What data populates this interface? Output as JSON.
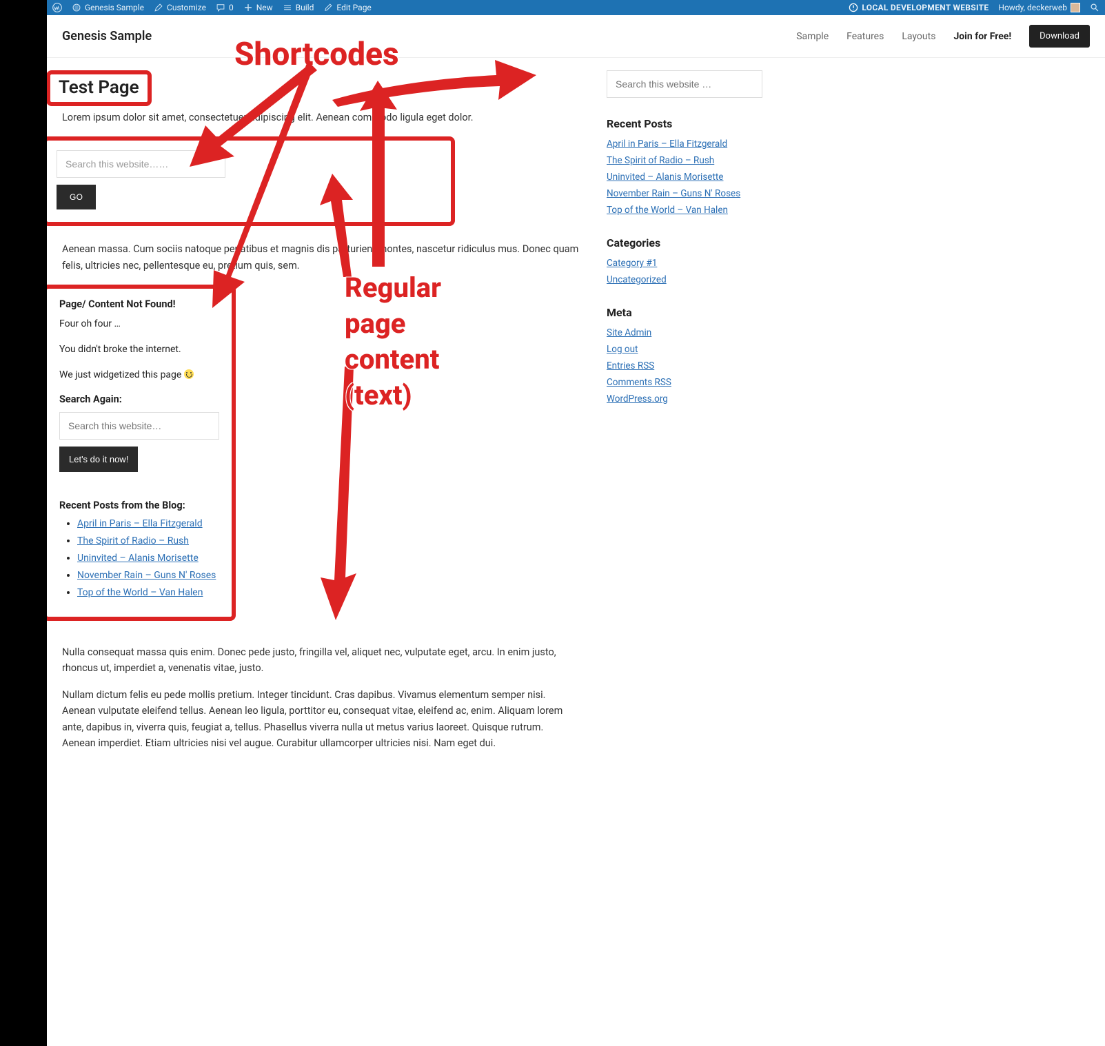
{
  "adminbar": {
    "site_name": "Genesis Sample",
    "customize": "Customize",
    "comments": "0",
    "new": "New",
    "build": "Build",
    "edit_page": "Edit Page",
    "local_dev": "LOCAL DEVELOPMENT WEBSITE",
    "howdy": "Howdy, deckerweb"
  },
  "header": {
    "title": "Genesis Sample",
    "nav": [
      "Sample",
      "Features",
      "Layouts"
    ],
    "nav_bold": "Join for Free!",
    "download": "Download"
  },
  "annotations": {
    "shortcodes": "Shortcodes",
    "regular": "Regular page content (text)"
  },
  "main": {
    "page_title": "Test Page",
    "lorem": "Lorem ipsum dolor sit amet, consectetuer adipiscing elit. Aenean commodo ligula eget dolor.",
    "search1_ph": "Search this website……",
    "go": "GO",
    "para2": "Aenean massa. Cum sociis natoque penatibus et magnis dis parturient montes, nascetur ridiculus mus. Donec quam felis, ultricies nec, pellentesque eu, pretium quis, sem.",
    "widget": {
      "h404": "Page/ Content Not Found!",
      "p1": "Four oh four …",
      "p2": "You didn't broke the internet.",
      "p3": "We just widgetized this page ",
      "search_again": "Search Again:",
      "search2_ph": "Search this website…",
      "do_it": "Let's do it now!",
      "recent_h": "Recent Posts from the Blog:",
      "posts": [
        "April in Paris – Ella Fitzgerald",
        "The Spirit of Radio – Rush",
        "Uninvited – Alanis Morisette",
        "November Rain – Guns N' Roses",
        "Top of the World – Van Halen"
      ]
    },
    "para3": "Nulla consequat massa quis enim. Donec pede justo, fringilla vel, aliquet nec, vulputate eget, arcu. In enim justo, rhoncus ut, imperdiet a, venenatis vitae, justo.",
    "para4": "Nullam dictum felis eu pede mollis pretium. Integer tincidunt. Cras dapibus. Vivamus elementum semper nisi. Aenean vulputate eleifend tellus. Aenean leo ligula, porttitor eu, consequat vitae, eleifend ac, enim. Aliquam lorem ante, dapibus in, viverra quis, feugiat a, tellus. Phasellus viverra nulla ut metus varius laoreet. Quisque rutrum. Aenean imperdiet. Etiam ultricies nisi vel augue. Curabitur ullamcorper ultricies nisi. Nam eget dui."
  },
  "sidebar": {
    "search_ph": "Search this website …",
    "recent_h": "Recent Posts",
    "recent": [
      "April in Paris – Ella Fitzgerald",
      "The Spirit of Radio – Rush",
      "Uninvited – Alanis Morisette",
      "November Rain – Guns N' Roses",
      "Top of the World – Van Halen"
    ],
    "cat_h": "Categories",
    "cats": [
      "Category #1",
      "Uncategorized"
    ],
    "meta_h": "Meta",
    "meta": [
      "Site Admin",
      "Log out",
      "Entries RSS",
      "Comments RSS",
      "WordPress.org"
    ]
  }
}
